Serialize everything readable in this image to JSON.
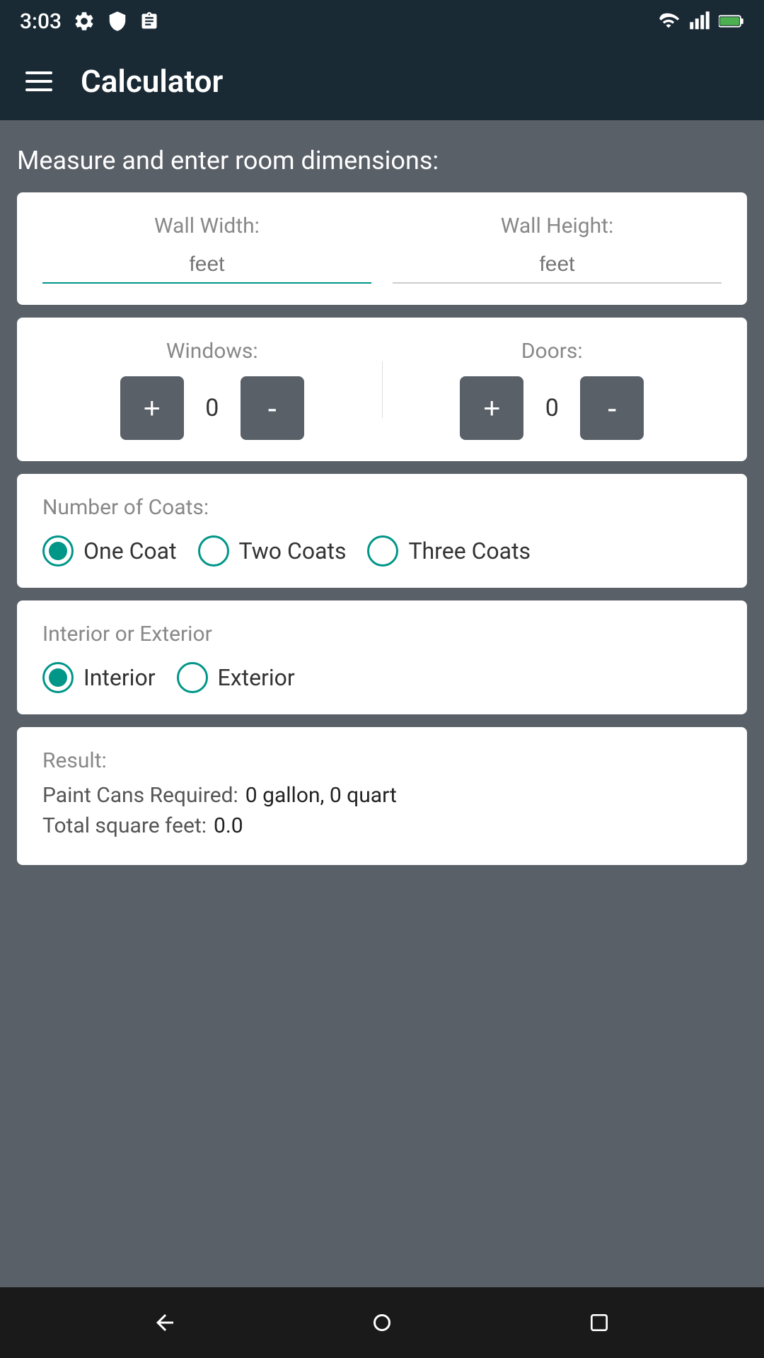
{
  "statusBar": {
    "time": "3:03",
    "icons": [
      "settings",
      "shield",
      "clipboard",
      "wifi",
      "signal",
      "battery"
    ]
  },
  "appBar": {
    "title": "Calculator",
    "menuIcon": "hamburger"
  },
  "mainInstruction": "Measure and enter room dimensions:",
  "dimensionsCard": {
    "wallWidthLabel": "Wall Width:",
    "wallWidthPlaceholder": "feet",
    "wallHeightLabel": "Wall Height:",
    "wallHeightPlaceholder": "feet"
  },
  "countersCard": {
    "windowsLabel": "Windows:",
    "windowsValue": "0",
    "windowsPlusLabel": "+",
    "windowsMinusLabel": "-",
    "doorsLabel": "Doors:",
    "doorsValue": "0",
    "doorsPlusLabel": "+",
    "doorsMinusLabel": "-"
  },
  "coatsCard": {
    "sectionLabel": "Number of Coats:",
    "options": [
      {
        "id": "one-coat",
        "label": "One Coat",
        "checked": true
      },
      {
        "id": "two-coats",
        "label": "Two Coats",
        "checked": false
      },
      {
        "id": "three-coats",
        "label": "Three Coats",
        "checked": false
      }
    ]
  },
  "interiorExteriorCard": {
    "sectionLabel": "Interior or Exterior",
    "options": [
      {
        "id": "interior",
        "label": "Interior",
        "checked": true
      },
      {
        "id": "exterior",
        "label": "Exterior",
        "checked": false
      }
    ]
  },
  "resultCard": {
    "resultLabel": "Result:",
    "paintCansLabel": "Paint Cans Required:",
    "paintCansValue": "0 gallon, 0 quart",
    "totalSqFtLabel": "Total square feet:",
    "totalSqFtValue": "0.0"
  },
  "bottomNav": {
    "backLabel": "◀",
    "homeLabel": "●",
    "recentLabel": "■"
  }
}
